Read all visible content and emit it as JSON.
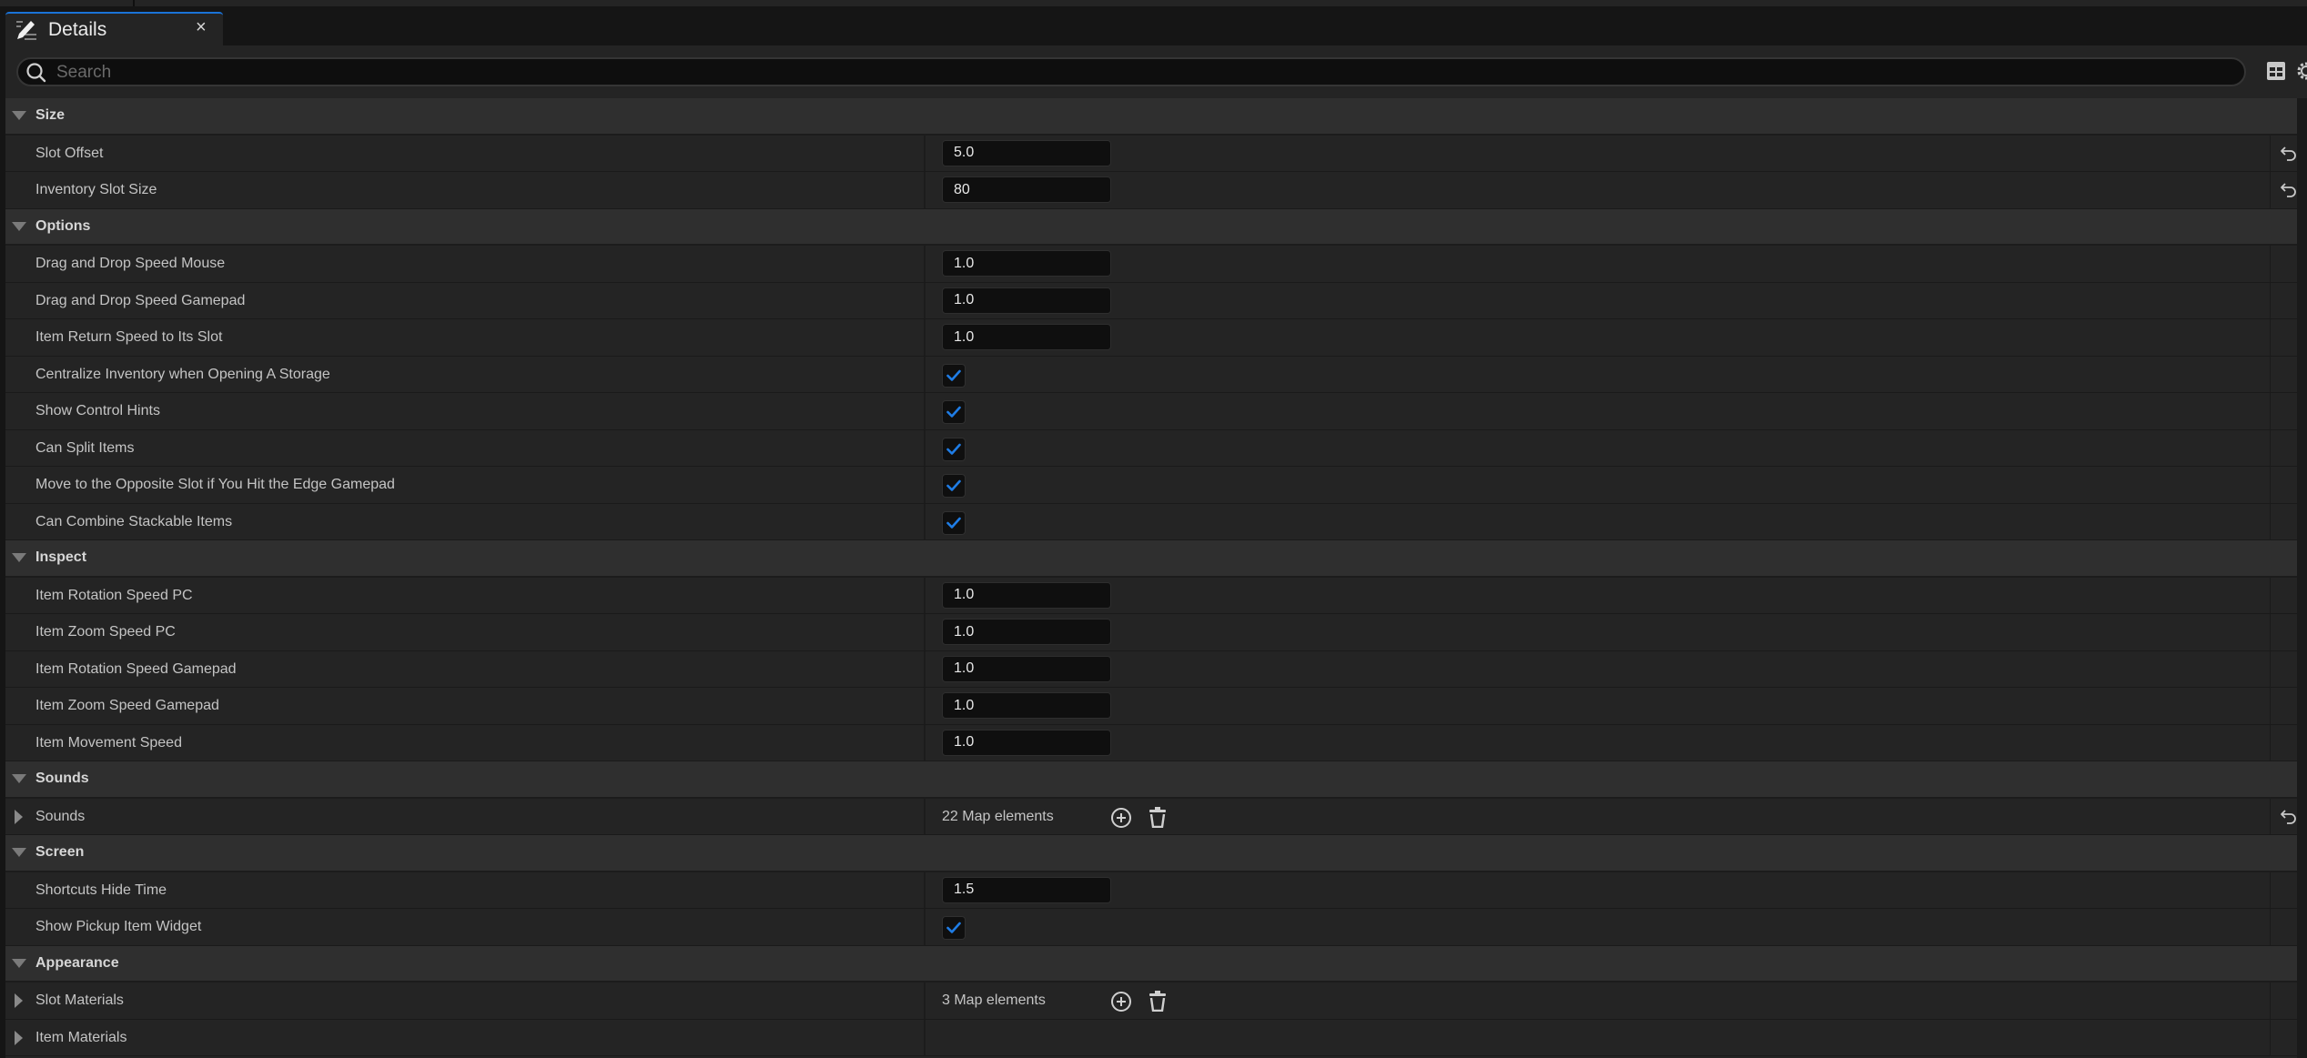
{
  "tab": {
    "title": "Details",
    "close_label": "×"
  },
  "search": {
    "placeholder": "Search",
    "value": ""
  },
  "colors": {
    "accent": "#1a73d8",
    "checkbox_check": "#1f7de6"
  },
  "sections": [
    {
      "title": "Size",
      "rows": [
        {
          "label": "Slot Offset",
          "type": "number",
          "value": "5.0",
          "reset": true
        },
        {
          "label": "Inventory Slot Size",
          "type": "number",
          "value": "80",
          "reset": true
        }
      ]
    },
    {
      "title": "Options",
      "rows": [
        {
          "label": "Drag and Drop Speed Mouse",
          "type": "number",
          "value": "1.0"
        },
        {
          "label": "Drag and Drop Speed Gamepad",
          "type": "number",
          "value": "1.0"
        },
        {
          "label": "Item Return Speed to Its Slot",
          "type": "number",
          "value": "1.0"
        },
        {
          "label": "Centralize Inventory when Opening A Storage",
          "type": "checkbox",
          "checked": true
        },
        {
          "label": "Show Control Hints",
          "type": "checkbox",
          "checked": true
        },
        {
          "label": "Can Split Items",
          "type": "checkbox",
          "checked": true
        },
        {
          "label": "Move to the Opposite Slot if You Hit the Edge Gamepad",
          "type": "checkbox",
          "checked": true
        },
        {
          "label": "Can Combine Stackable Items",
          "type": "checkbox",
          "checked": true
        }
      ]
    },
    {
      "title": "Inspect",
      "rows": [
        {
          "label": "Item Rotation Speed PC",
          "type": "number",
          "value": "1.0"
        },
        {
          "label": "Item Zoom Speed PC",
          "type": "number",
          "value": "1.0"
        },
        {
          "label": "Item Rotation Speed Gamepad",
          "type": "number",
          "value": "1.0"
        },
        {
          "label": "Item Zoom Speed Gamepad",
          "type": "number",
          "value": "1.0"
        },
        {
          "label": "Item Movement Speed",
          "type": "number",
          "value": "1.0"
        }
      ]
    },
    {
      "title": "Sounds",
      "rows": [
        {
          "label": "Sounds",
          "type": "map",
          "value": "22 Map elements",
          "expandable": true,
          "reset": true
        }
      ]
    },
    {
      "title": "Screen",
      "rows": [
        {
          "label": "Shortcuts Hide Time",
          "type": "number",
          "value": "1.5"
        },
        {
          "label": "Show Pickup Item Widget",
          "type": "checkbox",
          "checked": true
        }
      ]
    },
    {
      "title": "Appearance",
      "rows": [
        {
          "label": "Slot Materials",
          "type": "map",
          "value": "3 Map elements",
          "expandable": true
        },
        {
          "label": "Item Materials",
          "type": "empty",
          "expandable": true
        }
      ]
    }
  ]
}
